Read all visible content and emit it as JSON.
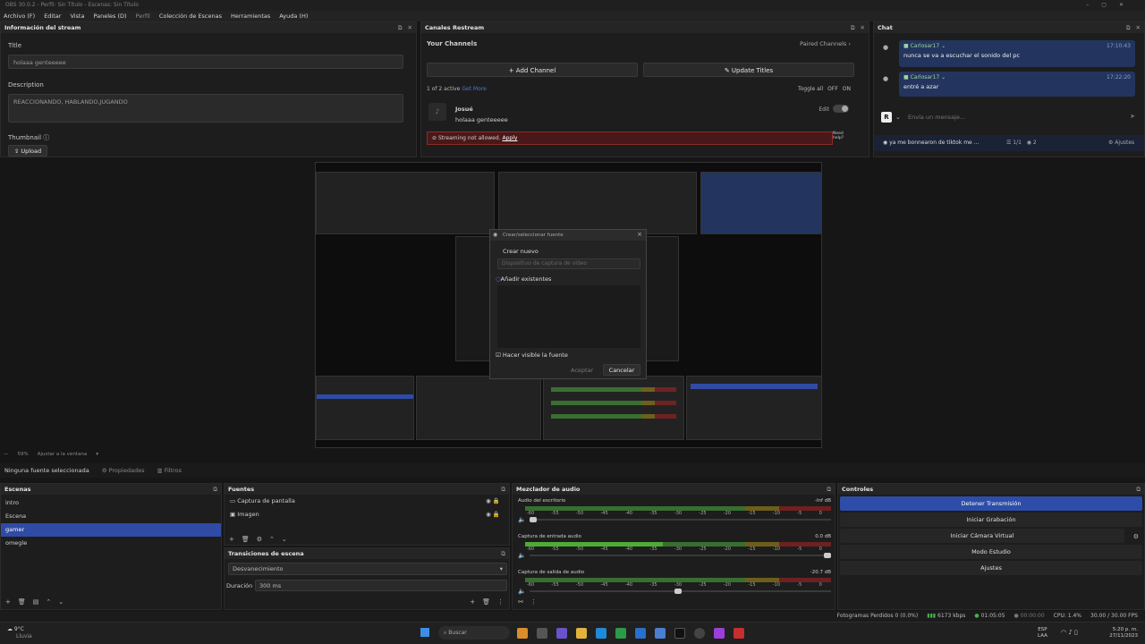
{
  "window": {
    "title": "OBS 30.0.2 - Perfil: Sin Título - Escenas: Sin Título"
  },
  "menu": [
    "Archivo (F)",
    "Editar",
    "Vista",
    "Paneles (D)",
    "Perfil",
    "Colección de Escenas",
    "Herramientas",
    "Ayuda (H)"
  ],
  "stream_info": {
    "header": "Información del stream",
    "title_label": "Title",
    "title_value": "holaaa genteeeee",
    "description_label": "Description",
    "description_value": "REACCIONANDO, HABLANDO,JUGANDO",
    "thumbnail_label": "Thumbnail",
    "upload_label": "Upload"
  },
  "restream": {
    "header": "Canales Restream",
    "your_channels": "Your Channels",
    "paired_channels": "Paired Channels",
    "add_channel": "Add Channel",
    "update_titles": "Update Titles",
    "active_count": "1 of 2 active",
    "get_more": "Get More",
    "toggle_all": "Toggle all",
    "off": "OFF",
    "on": "ON",
    "channel_name": "Josué",
    "channel_title": "holaaa genteeeee",
    "edit": "Edit",
    "error_text": "Streaming not allowed.",
    "apply": "Apply",
    "need_help": "Need help?"
  },
  "chat": {
    "header": "Chat",
    "messages": [
      {
        "user": "Carlosar17",
        "time": "17:10:43",
        "text": "nunca se va a escuchar el sonido del pc"
      },
      {
        "user": "Carlosar17",
        "time": "17:22:20",
        "text": "entré a azar"
      }
    ],
    "input_placeholder": "Envía un mensaje...",
    "footer_text": "ya me bonnearon de tiktok me ...",
    "footer_count1": "1/1",
    "footer_count2": "2",
    "settings": "Ajustes"
  },
  "preview": {
    "dialog_title": "Crear/seleccionar fuente",
    "create_new": "Crear nuevo",
    "create_new_value": "Dispositivo de captura de vídeo",
    "add_existing": "Añadir existentes",
    "make_visible": "Hacer visible la fuente",
    "accept": "Aceptar",
    "cancel": "Cancelar"
  },
  "zoom_bar": {
    "zoom": "59%",
    "fit": "Ajustar a la ventana"
  },
  "source_toolbar": {
    "no_source": "Ninguna fuente seleccionada",
    "properties": "Propiedades",
    "filters": "Filtros"
  },
  "scenes": {
    "header": "Escenas",
    "items": [
      "intro",
      "Escena",
      "gamer",
      "omegle"
    ],
    "selected": 2
  },
  "sources": {
    "header": "Fuentes",
    "items": [
      "Captura de pantalla",
      "Imagen"
    ]
  },
  "transitions": {
    "header": "Transiciones de escena",
    "type": "Desvanecimiento",
    "duration_label": "Duración",
    "duration_value": "300 ms"
  },
  "mixer": {
    "header": "Mezclador de audio",
    "channels": [
      {
        "name": "Audio del escritorio",
        "db": "-Inf dB"
      },
      {
        "name": "Captura de entrada audio",
        "db": "0.0 dB"
      },
      {
        "name": "Captura de salida de audio",
        "db": "-20.7 dB"
      }
    ],
    "ticks": [
      "-60",
      "-55",
      "-50",
      "-45",
      "-40",
      "-35",
      "-30",
      "-25",
      "-20",
      "-15",
      "-10",
      "-5",
      "0"
    ]
  },
  "controls": {
    "header": "Controles",
    "buttons": [
      "Detener Transmisión",
      "Iniciar Grabación",
      "Iniciar Cámara Virtual",
      "Modo Estudio",
      "Ajustes"
    ]
  },
  "status": {
    "dropped": "Fotogramas Perdidos 0 (0.0%)",
    "bitrate": "6173 kbps",
    "live_time": "01:05:05",
    "rec_time": "00:00:00",
    "cpu": "CPU: 1.4%",
    "fps": "30.00 / 30.00 FPS"
  },
  "taskbar": {
    "weather": "9°C",
    "weather_desc": "Lluvia",
    "search": "Buscar",
    "lang": "ESP",
    "lang2": "LAA",
    "time": "5:20 p. m.",
    "date": "27/11/2023"
  },
  "colors": {
    "accent": "#2f4ba5",
    "error": "#b02a2a",
    "bg": "#161616"
  }
}
